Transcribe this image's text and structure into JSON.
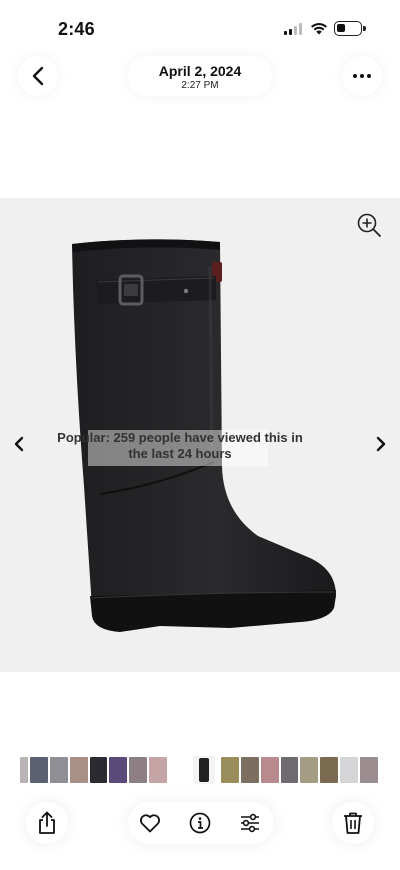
{
  "status_bar": {
    "time": "2:46",
    "battery_level": 0.3
  },
  "header": {
    "date": "April 2, 2024",
    "time": "2:27 PM",
    "back_icon": "chevron-left-icon",
    "more_icon": "ellipsis-icon"
  },
  "photo": {
    "overlay_text": "Popular: 259 people have viewed this in the last 24 hours",
    "background_color": "#f0f0f0",
    "zoom_icon": "zoom-in-icon",
    "prev_icon": "chevron-left-icon",
    "next_icon": "chevron-right-icon"
  },
  "thumbnails": {
    "colors_before": [
      "#b9b3b5",
      "#5b6170",
      "#8f8e95",
      "#a99086",
      "#2a2a30",
      "#5a4a7a",
      "#8c7e83",
      "#c5a4a6"
    ],
    "current_color": "#222222",
    "colors_after": [
      "#9a8d5c",
      "#7d6e62",
      "#b88a8e",
      "#6e6a70",
      "#a59c84",
      "#7a6a50",
      "#d5d5d8",
      "#9b8c90"
    ]
  },
  "toolbar": {
    "share_icon": "share-icon",
    "favorite_icon": "heart-icon",
    "info_icon": "info-icon",
    "adjust_icon": "adjust-sliders-icon",
    "delete_icon": "trash-icon"
  }
}
